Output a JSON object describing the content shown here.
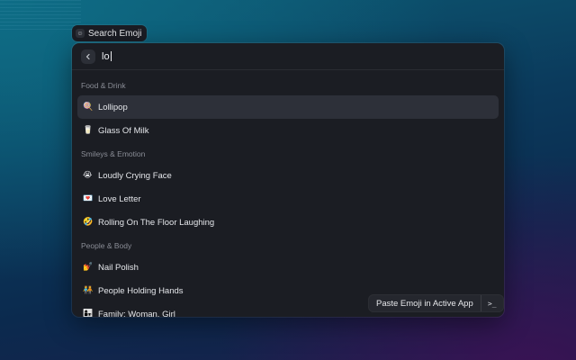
{
  "command_pill": {
    "label": "Search Emoji",
    "icon": "emoji-command-icon"
  },
  "search": {
    "value": "lo",
    "back_icon": "chevron-left-icon"
  },
  "sections": [
    {
      "title": "Food & Drink",
      "items": [
        {
          "emoji": "🍭",
          "label": "Lollipop",
          "selected": true
        },
        {
          "emoji": "🥛",
          "label": "Glass Of Milk",
          "selected": false
        }
      ]
    },
    {
      "title": "Smileys & Emotion",
      "items": [
        {
          "emoji": "😭",
          "label": "Loudly Crying Face",
          "selected": false
        },
        {
          "emoji": "💌",
          "label": "Love Letter",
          "selected": false
        },
        {
          "emoji": "🤣",
          "label": "Rolling On The Floor Laughing",
          "selected": false
        }
      ]
    },
    {
      "title": "People & Body",
      "items": [
        {
          "emoji": "💅",
          "label": "Nail Polish",
          "selected": false
        },
        {
          "emoji": "🧑‍🤝‍🧑",
          "label": "People Holding Hands",
          "selected": false
        },
        {
          "emoji": "👩‍👧",
          "label": "Family: Woman, Girl",
          "selected": false
        }
      ]
    }
  ],
  "footer": {
    "primary_action": "Paste Emoji in Active App",
    "secondary_action": ">_"
  }
}
